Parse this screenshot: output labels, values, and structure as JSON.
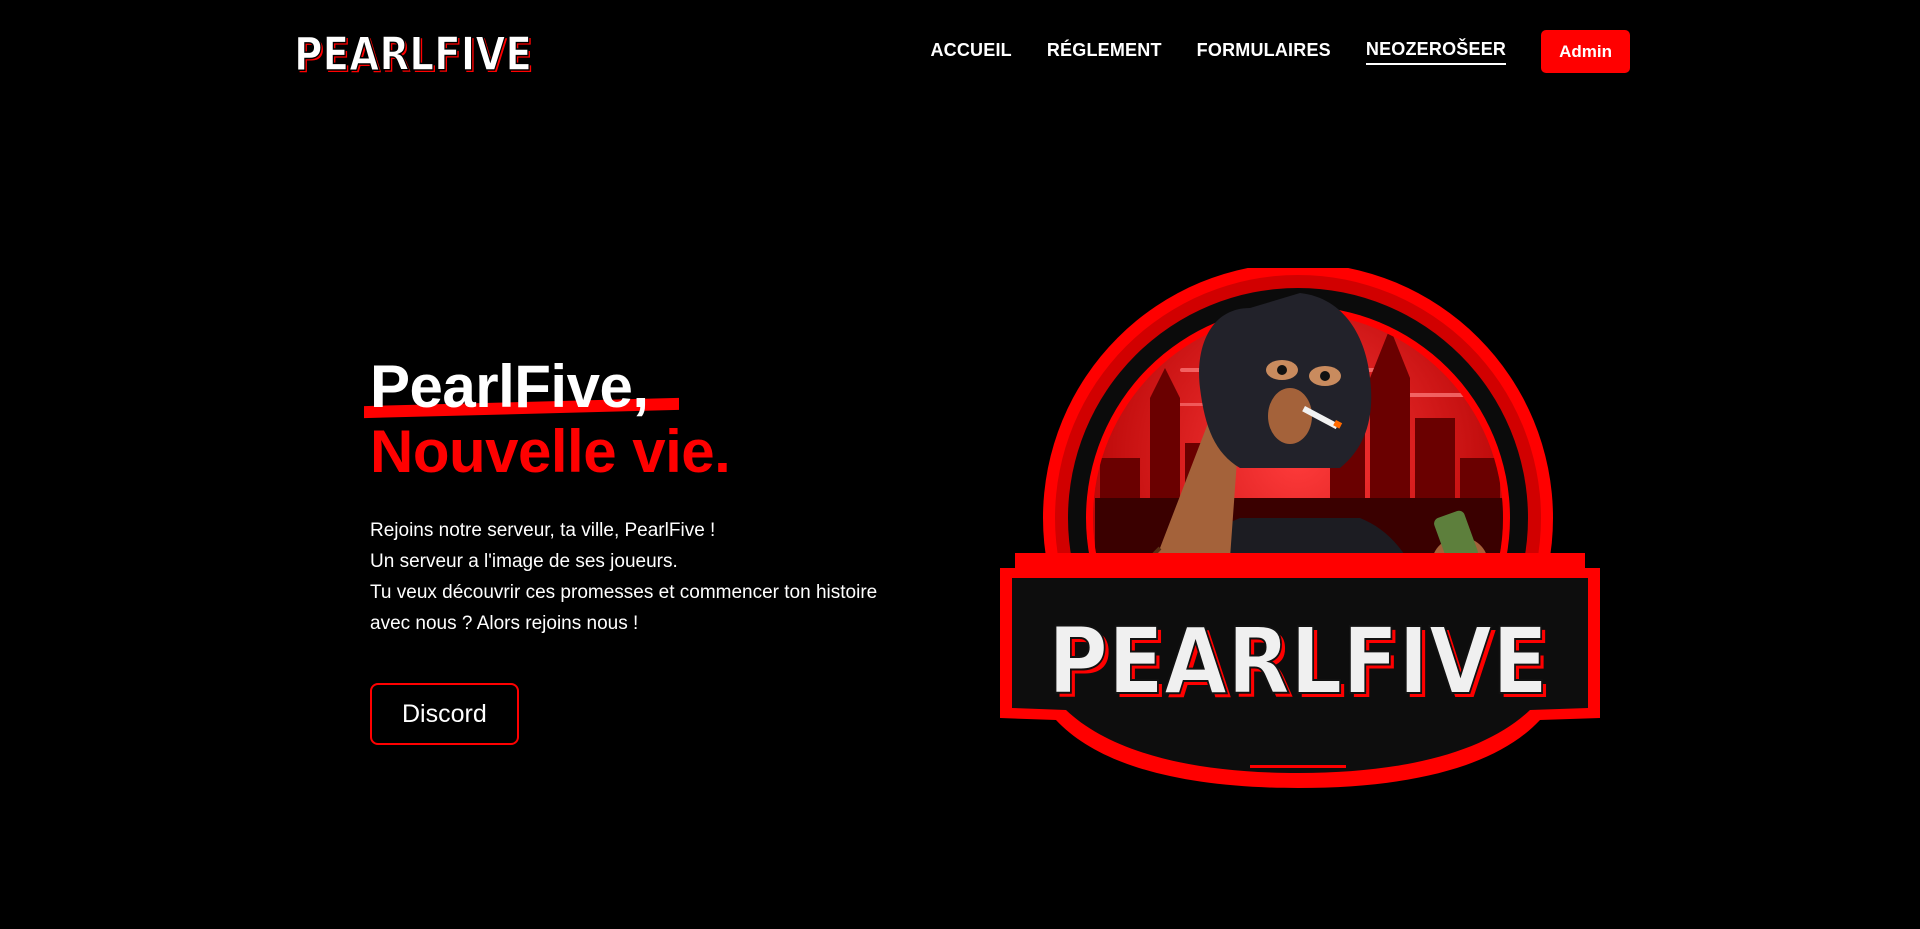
{
  "brand": {
    "logo_text": "PEARLFIVE"
  },
  "nav": {
    "items": [
      {
        "label": "ACCUEIL",
        "active": false
      },
      {
        "label": "RÉGLEMENT",
        "active": false
      },
      {
        "label": "FORMULAIRES",
        "active": false
      },
      {
        "label": "NEOZEROŠEER",
        "active": true
      }
    ],
    "admin_label": "Admin"
  },
  "hero": {
    "title_line1": "PearlFive,",
    "title_line2": "Nouvelle vie.",
    "description": [
      "Rejoins notre serveur, ta ville, PearlFive !",
      "Un serveur a l'image de ses joueurs.",
      "Tu veux découvrir ces promesses et commencer ton histoire",
      "avec nous ? Alors rejoins nous !"
    ],
    "cta_label": "Discord"
  },
  "emblem": {
    "logo_text": "PEARLFIVE"
  },
  "colors": {
    "accent": "#ff0000",
    "background": "#000000",
    "text": "#ffffff"
  }
}
